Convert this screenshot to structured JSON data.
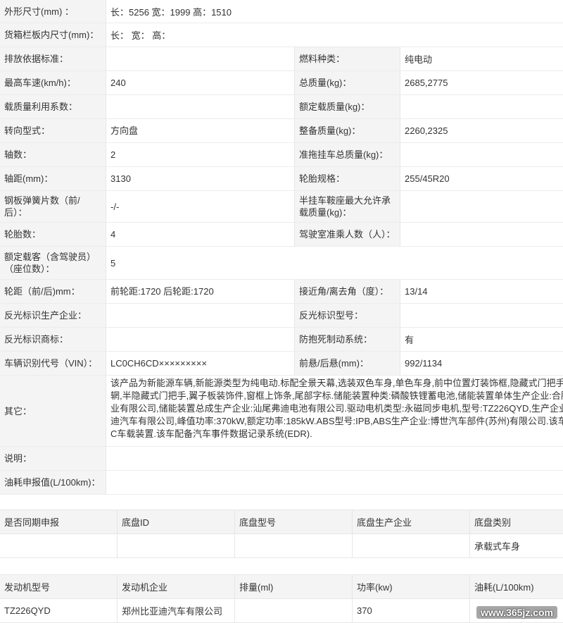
{
  "spec": {
    "rows": [
      {
        "label": "外形尺寸(mm) ：",
        "value": "长：5256 宽：1999 高：1510"
      },
      {
        "label": "货箱栏板内尺寸(mm)：",
        "value": "长： 宽： 高："
      },
      {
        "label": "排放依据标准：",
        "value": "",
        "label2": "燃料种类：",
        "value2": "纯电动"
      },
      {
        "label": "最高车速(km/h)：",
        "value": "240",
        "label2": "总质量(kg)：",
        "value2": "2685,2775"
      },
      {
        "label": "载质量利用系数：",
        "value": "",
        "label2": "额定载质量(kg)：",
        "value2": ""
      },
      {
        "label": "转向型式：",
        "value": "方向盘",
        "label2": "整备质量(kg)：",
        "value2": "2260,2325"
      },
      {
        "label": "轴数：",
        "value": "2",
        "label2": "准拖挂车总质量(kg)：",
        "value2": ""
      },
      {
        "label": "轴距(mm)：",
        "value": "3130",
        "label2": "轮胎规格：",
        "value2": "255/45R20"
      },
      {
        "label": "钢板弹簧片数（前/后）：",
        "value": "-/-",
        "label2": "半挂车鞍座最大允许承载质量(kg)：",
        "value2": ""
      },
      {
        "label": "轮胎数：",
        "value": "4",
        "label2": "驾驶室准乘人数（人）：",
        "value2": ""
      },
      {
        "label": "额定载客（含驾驶员）（座位数）：",
        "value": "5"
      },
      {
        "label": "轮距（前/后)mm：",
        "value": "前轮距:1720 后轮距:1720",
        "label2": "接近角/离去角（度）：",
        "value2": "13/14"
      },
      {
        "label": "反光标识生产企业：",
        "value": "",
        "label2": "反光标识型号：",
        "value2": ""
      },
      {
        "label": "反光标识商标：",
        "value": "",
        "label2": "防抱死制动系统：",
        "value2": "有"
      },
      {
        "label": "车辆识别代号（VIN）：",
        "value": "LC0CH6CD×××××××××",
        "label2": "前悬/后悬(mm)：",
        "value2": "992/1134"
      },
      {
        "label": "其它：",
        "lines": [
          "该产品为新能源车辆,新能源类型为纯电动.标配全景天幕,选装双色车身,单色车身,前中位置灯装饰框,隐藏式门把手,轮芯盖",
          "辋,半隐藏式门把手,翼子板装饰件,窗框上饰条,尾部字标.储能装置种类:磷酸铁锂蓄电池,储能装置单体生产企业:合肥比亚迪",
          "业有限公司,储能装置总成生产企业:汕尾弗迪电池有限公司.驱动电机类型:永磁同步电机,型号:TZ226QYD,生产企业:郑州比",
          "迪汽车有限公司,峰值功率:370kW,额定功率:185kW.ABS型号:IPB,ABS生产企业:博世汽车部件(苏州)有限公司.该车型可选",
          "C车载装置.该车配备汽车事件数据记录系统(EDR)."
        ]
      },
      {
        "label": "说明：",
        "value": ""
      },
      {
        "label": "油耗申报值(L/100km)：",
        "value": ""
      }
    ]
  },
  "chassis": {
    "headers": [
      "是否同期申报",
      "底盘ID",
      "底盘型号",
      "底盘生产企业",
      "底盘类别"
    ],
    "row": [
      "",
      "",
      "",
      "",
      "承载式车身"
    ]
  },
  "engine": {
    "headers": [
      "发动机型号",
      "发动机企业",
      "排量(ml)",
      "功率(kw)",
      "油耗(L/100km)"
    ],
    "row": [
      "TZ226QYD",
      "郑州比亚迪汽车有限公司",
      "",
      "370",
      ""
    ]
  },
  "watermark": "www.365jz.com"
}
